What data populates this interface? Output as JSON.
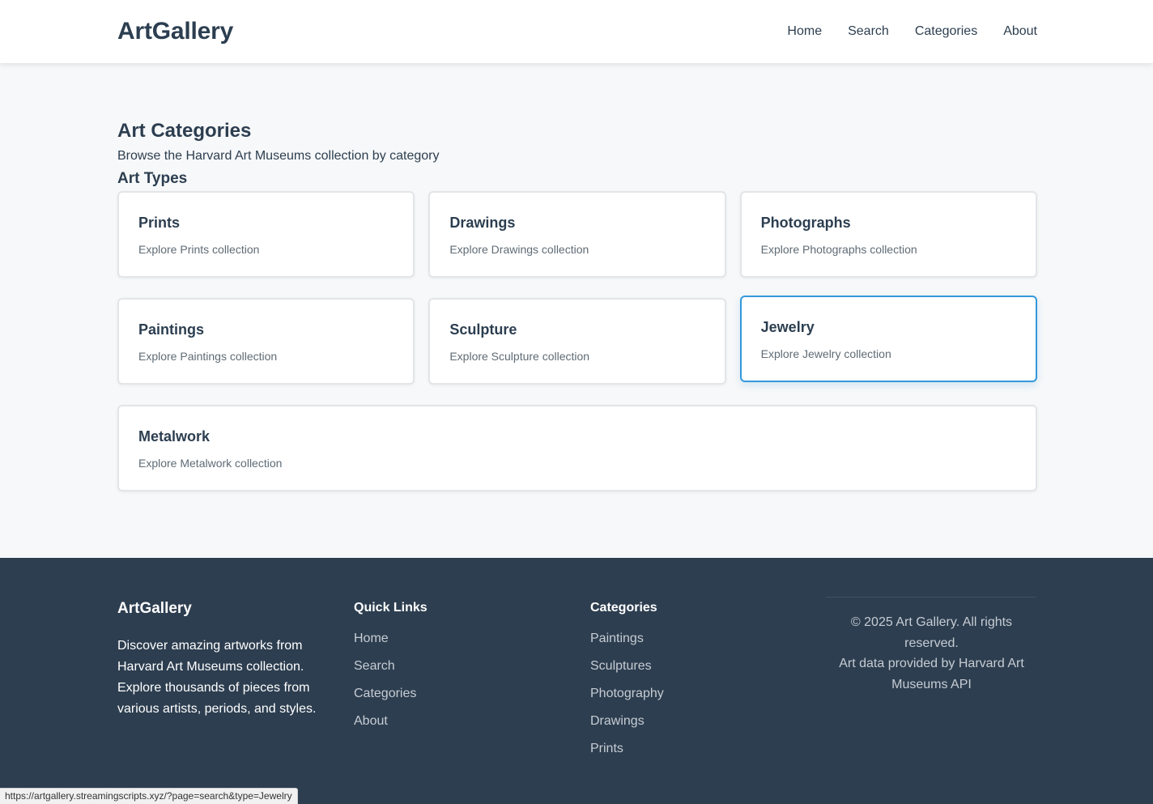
{
  "header": {
    "logo": "ArtGallery",
    "nav": [
      "Home",
      "Search",
      "Categories",
      "About"
    ]
  },
  "main": {
    "title": "Art Categories",
    "subtitle": "Browse the Harvard Art Museums collection by category",
    "section_title": "Art Types",
    "categories": [
      {
        "title": "Prints",
        "description": "Explore Prints collection"
      },
      {
        "title": "Drawings",
        "description": "Explore Drawings collection"
      },
      {
        "title": "Photographs",
        "description": "Explore Photographs collection"
      },
      {
        "title": "Paintings",
        "description": "Explore Paintings collection"
      },
      {
        "title": "Sculpture",
        "description": "Explore Sculpture collection"
      },
      {
        "title": "Jewelry",
        "description": "Explore Jewelry collection"
      },
      {
        "title": "Metalwork",
        "description": "Explore Metalwork collection"
      }
    ]
  },
  "footer": {
    "brand": "ArtGallery",
    "about": "Discover amazing artworks from Harvard Art Museums collection. Explore thousands of pieces from various artists, periods, and styles.",
    "quick_links_heading": "Quick Links",
    "quick_links": [
      "Home",
      "Search",
      "Categories",
      "About"
    ],
    "categories_heading": "Categories",
    "category_links": [
      "Paintings",
      "Sculptures",
      "Photography",
      "Drawings",
      "Prints"
    ],
    "copyright": "© 2025 Art Gallery. All rights reserved.",
    "credit": "Art data provided by Harvard Art Museums API"
  },
  "status_bar": {
    "url": "https://artgallery.streamingscripts.xyz/?page=search&type=Jewelry"
  },
  "colors": {
    "primary": "#2c3e50",
    "footer_bg": "#2d3e50",
    "accent": "#3498db",
    "page_bg": "#f7f8f9"
  }
}
